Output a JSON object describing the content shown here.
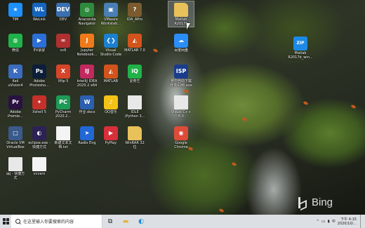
{
  "desktop": {
    "icons": [
      {
        "label": "TIM",
        "icon": "tim-icon",
        "color": "#1e90ff",
        "glyph": "★"
      },
      {
        "label": "WeLink",
        "icon": "welink-icon",
        "color": "#1565c0",
        "glyph": "WL"
      },
      {
        "label": "DEV",
        "icon": "devcpp-icon",
        "color": "#3a6fb0",
        "glyph": "DEV"
      },
      {
        "label": "Anaconda\nNavigator",
        "icon": "anaconda-icon",
        "color": "#2e8b3e",
        "glyph": "◎"
      },
      {
        "label": "VMware\nWorkstati...",
        "icon": "vmware-icon",
        "color": "#4a7fb5",
        "glyph": "▣"
      },
      {
        "label": "IDA_APro",
        "icon": "ida-icon",
        "color": "#7a5a2e",
        "glyph": "?"
      },
      {
        "label": "Matlab\nR2017b",
        "icon": "folder-icon",
        "color": "#e8c15a",
        "glyph": "",
        "selected": true
      },
      {
        "label": "微信",
        "icon": "wechat-icon",
        "color": "#20b24a",
        "glyph": "◍"
      },
      {
        "label": "EV录屏",
        "icon": "evcapture-icon",
        "color": "#2c6fd6",
        "glyph": "▶"
      },
      {
        "label": "vc6",
        "icon": "vc6-icon",
        "color": "#b03030",
        "glyph": "∞"
      },
      {
        "label": "Jupyter\nNotebook...",
        "icon": "jupyter-icon",
        "color": "#f07a1a",
        "glyph": "J"
      },
      {
        "label": "Visual\nStudio Code",
        "icon": "vscode-icon",
        "color": "#1c7fd0",
        "glyph": "❮❯"
      },
      {
        "label": "MATLAB 7.0",
        "icon": "matlab-icon",
        "color": "#d2541c",
        "glyph": "◭"
      },
      {
        "label": "百度网盘",
        "icon": "baidu-netdisk-icon",
        "color": "#2b8df7",
        "glyph": "☁"
      },
      {
        "label": "Keil\nuVision4",
        "icon": "keil-icon",
        "color": "#3b6cc0",
        "glyph": "K"
      },
      {
        "label": "Adobe\nPhotosho...",
        "icon": "photoshop-icon",
        "color": "#0b1e3a",
        "glyph": "Ps"
      },
      {
        "label": "Xftp 5",
        "icon": "xftp-icon",
        "color": "#d6452a",
        "glyph": "X"
      },
      {
        "label": "IntelliJ IDEA\n2020.2 x64",
        "icon": "intellij-icon",
        "color": "#c2295e",
        "glyph": "IJ"
      },
      {
        "label": "MATLAB",
        "icon": "matlab-icon",
        "color": "#d2541c",
        "glyph": "◭"
      },
      {
        "label": "爱奇艺",
        "icon": "iqiyi-icon",
        "color": "#21b24a",
        "glyph": "iQ"
      },
      {
        "label": "普中自动下载\n软件1.86.exe",
        "icon": "isp-icon",
        "color": "#1a3c8c",
        "glyph": "ISP"
      },
      {
        "label": "Adobe\nPremie...",
        "icon": "premiere-icon",
        "color": "#2a1240",
        "glyph": "Pr"
      },
      {
        "label": "Xshell 5",
        "icon": "xshell-icon",
        "color": "#c4302a",
        "glyph": "✦"
      },
      {
        "label": "PyCharm\n2020.2...",
        "icon": "pycharm-icon",
        "color": "#1d9a56",
        "glyph": "PC"
      },
      {
        "label": "作业.docx",
        "icon": "word-doc-icon",
        "color": "#2b5fb0",
        "glyph": "W"
      },
      {
        "label": "QQ音乐",
        "icon": "qqmusic-icon",
        "color": "#f2c316",
        "glyph": "♪"
      },
      {
        "label": "IDLE\n(Python 3...",
        "icon": "file-icon",
        "color": "#e8e8e8",
        "glyph": ""
      },
      {
        "label": "Visual C++\n6.0",
        "icon": "file-icon",
        "color": "#e8e8e8",
        "glyph": ""
      },
      {
        "label": "Oracle VM\nVirtualBox",
        "icon": "virtualbox-icon",
        "color": "#3a5a8c",
        "glyph": "□"
      },
      {
        "label": "eclipse.exe -\n快捷方式",
        "icon": "eclipse-icon",
        "color": "#2c2255",
        "glyph": "◐"
      },
      {
        "label": "新建文本文\n档.txt",
        "icon": "text-file-icon",
        "color": "#f4f4f4",
        "glyph": ""
      },
      {
        "label": "Radio Eng",
        "icon": "radio-icon",
        "color": "#2167d6",
        "glyph": "➤"
      },
      {
        "label": "PyPlay",
        "icon": "pyplay-icon",
        "color": "#d82f3a",
        "glyph": "▶"
      },
      {
        "label": "WinRAR 32\n位",
        "icon": "folder-icon",
        "color": "#e8c15a",
        "glyph": ""
      },
      {
        "label": "Google\nChrome",
        "icon": "chrome-icon",
        "color": "#dd4b39",
        "glyph": "◉"
      },
      {
        "label": "qq - 快捷方\n式",
        "icon": "file-icon",
        "color": "#e8e8e8",
        "glyph": ""
      },
      {
        "label": "vcvars",
        "icon": "text-file-icon",
        "color": "#f4f4f4",
        "glyph": ""
      }
    ],
    "right_icons": [
      {
        "label": "Matlab\nR2017b_win...",
        "icon": "zip-icon",
        "color": "#1c8ae6",
        "glyph": "ZIP"
      }
    ]
  },
  "wallpaper": {
    "watermark": "Bing"
  },
  "taskbar": {
    "search_placeholder": "在这里输入你要搜索的内容",
    "pinned": [
      {
        "name": "task-view-icon",
        "glyph": "⧉",
        "color": "#222"
      },
      {
        "name": "file-explorer-icon",
        "glyph": "▬",
        "color": "#e3b23c"
      },
      {
        "name": "edge-icon",
        "glyph": "◐",
        "color": "#1f8ad9"
      }
    ],
    "tray": {
      "arrow": "^",
      "lang": "中"
    },
    "clock": {
      "time": "下午 4:15",
      "date": "2020/10/..."
    }
  }
}
